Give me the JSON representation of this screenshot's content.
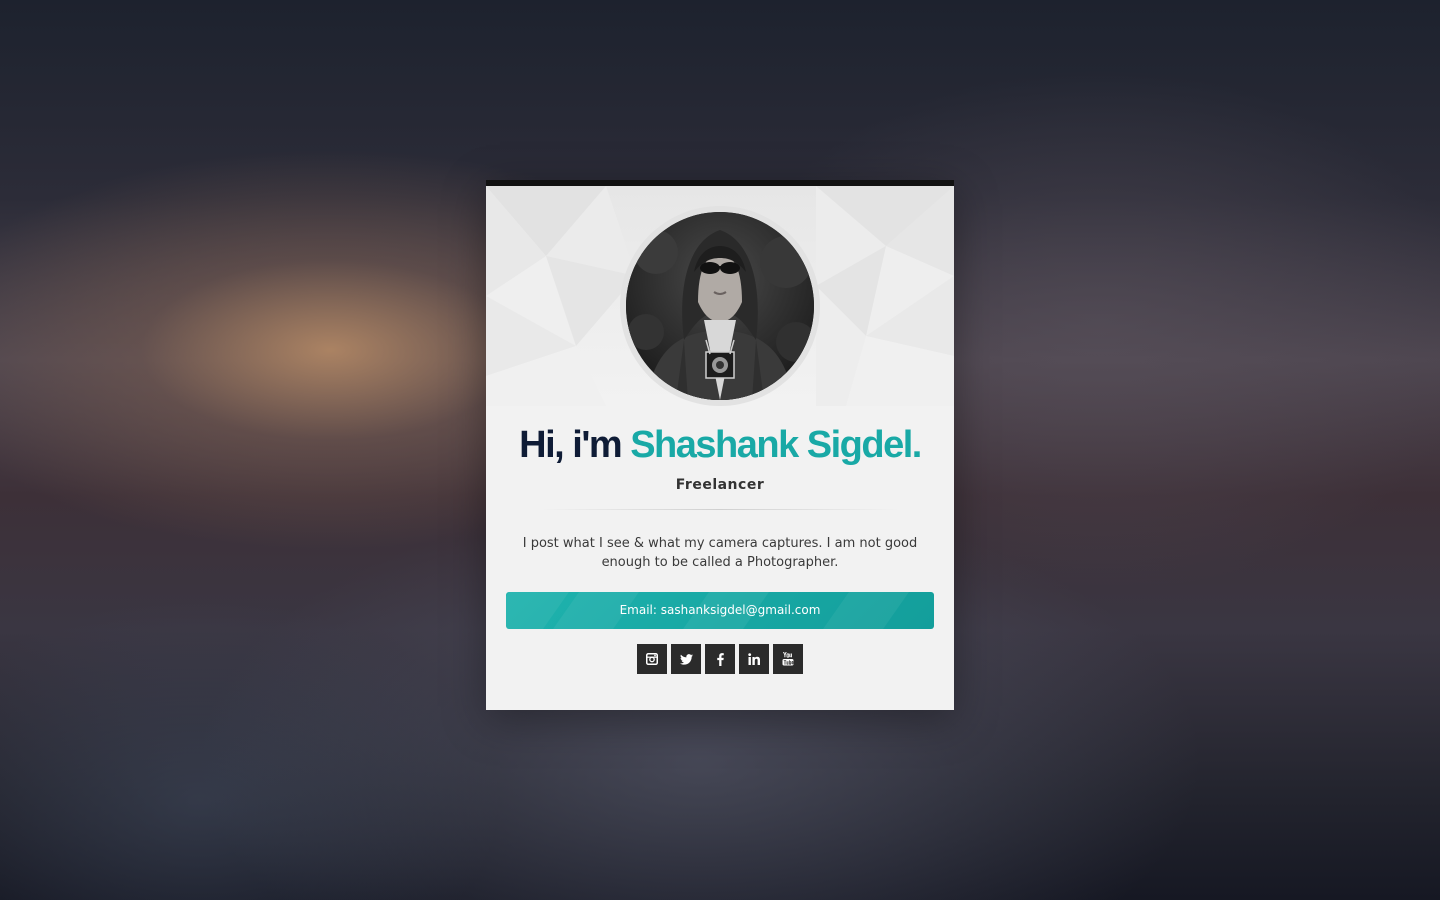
{
  "profile": {
    "greeting": "Hi, i'm ",
    "name": "Shashank Sigdel.",
    "role": "Freelancer",
    "bio": "I post what I see & what my camera captures. I am not good enough to be called a Photographer.",
    "email_label": "Email: sashanksigdel@gmail.com",
    "avatar": "profile-photo"
  },
  "socials": [
    {
      "icon": "instagram-icon"
    },
    {
      "icon": "twitter-icon"
    },
    {
      "icon": "facebook-icon"
    },
    {
      "icon": "linkedin-icon"
    },
    {
      "icon": "youtube-icon"
    }
  ],
  "colors": {
    "accent": "#19a9a6",
    "heading_dark": "#0f1c36",
    "card_top_border": "#111111",
    "social_bg": "#2b2b2b"
  }
}
